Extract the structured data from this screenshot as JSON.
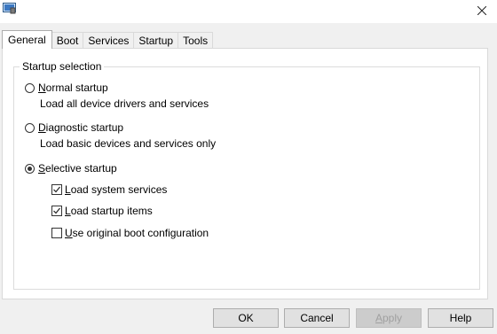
{
  "tabs": [
    "General",
    "Boot",
    "Services",
    "Startup",
    "Tools"
  ],
  "active_tab": "General",
  "group_title": "Startup selection",
  "options": {
    "normal": {
      "label": "Normal startup",
      "desc": "Load all device drivers and services",
      "checked": false
    },
    "diagnostic": {
      "label": "Diagnostic startup",
      "desc": "Load basic devices and services only",
      "checked": false
    },
    "selective": {
      "label": "Selective startup",
      "checked": true
    }
  },
  "checks": {
    "system_services": {
      "label": "Load system services",
      "checked": true
    },
    "startup_items": {
      "label": "Load startup items",
      "checked": true
    },
    "original_boot": {
      "label": "Use original boot configuration",
      "checked": false
    }
  },
  "buttons": {
    "ok": "OK",
    "cancel": "Cancel",
    "apply": "Apply",
    "help": "Help"
  },
  "colors": {
    "panel": "#ffffff",
    "dialog": "#f0f0f0",
    "button": "#e1e1e1"
  },
  "icons": {
    "app": "msconfig-icon",
    "close": "close-icon"
  }
}
